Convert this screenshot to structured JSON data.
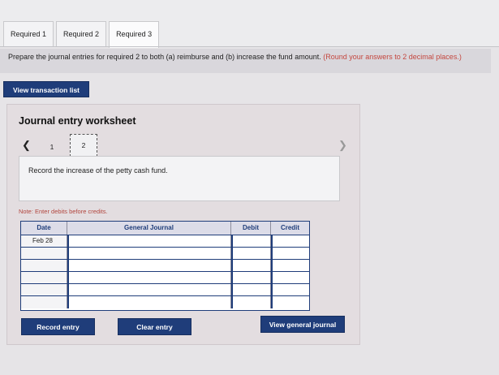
{
  "tabs": [
    {
      "label": "Required 1",
      "active": false
    },
    {
      "label": "Required 2",
      "active": false
    },
    {
      "label": "Required 3",
      "active": true
    }
  ],
  "instructions": {
    "text": "Prepare the journal entries for required 2 to both (a) reimburse and (b) increase the fund amount.",
    "hint": "(Round your answers to 2 decimal places.)"
  },
  "view_transaction_list_label": "View transaction list",
  "worksheet": {
    "title": "Journal entry worksheet",
    "pager": {
      "prev_icon": "chevron-left-icon",
      "next_icon": "chevron-right-icon",
      "pages": [
        "1",
        "2"
      ],
      "current": "2"
    },
    "description": "Record the increase of the petty cash fund.",
    "note": "Note: Enter debits before credits.",
    "table": {
      "headers": {
        "date": "Date",
        "account": "General Journal",
        "debit": "Debit",
        "credit": "Credit"
      },
      "rows": [
        {
          "date": "Feb 28",
          "account": "",
          "debit": "",
          "credit": ""
        },
        {
          "date": "",
          "account": "",
          "debit": "",
          "credit": ""
        },
        {
          "date": "",
          "account": "",
          "debit": "",
          "credit": ""
        },
        {
          "date": "",
          "account": "",
          "debit": "",
          "credit": ""
        },
        {
          "date": "",
          "account": "",
          "debit": "",
          "credit": ""
        },
        {
          "date": "",
          "account": "",
          "debit": "",
          "credit": ""
        }
      ]
    },
    "buttons": {
      "record": "Record entry",
      "clear": "Clear entry",
      "view_general_journal": "View general journal"
    }
  },
  "colors": {
    "primary": "#1f3d7a",
    "hint": "#c4473f"
  }
}
